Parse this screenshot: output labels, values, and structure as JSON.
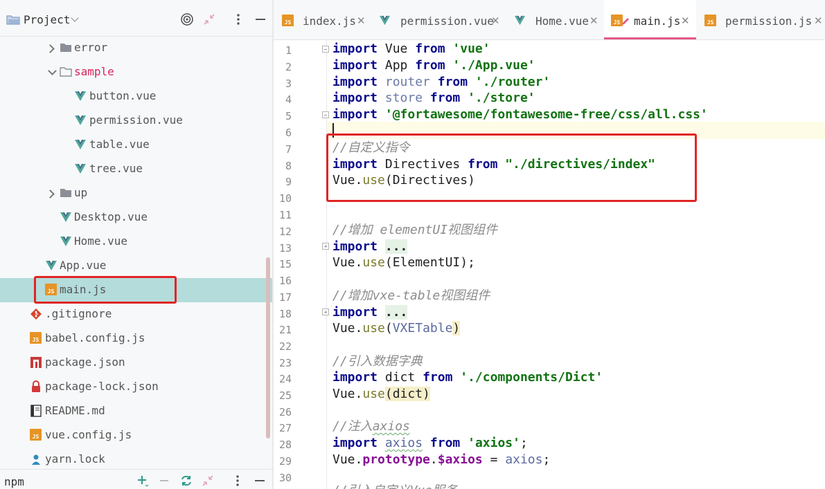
{
  "project_panel": {
    "title": "Project",
    "colors": {
      "selected_row": "#b3dcdb",
      "red_label": "#d6245b",
      "highlight_box": "#e02424"
    },
    "tree": [
      {
        "label": "error",
        "type": "folder",
        "expanded": false
      },
      {
        "label": "sample",
        "type": "folder",
        "expanded": true
      },
      {
        "label": "button.vue",
        "type": "vue"
      },
      {
        "label": "permission.vue",
        "type": "vue"
      },
      {
        "label": "table.vue",
        "type": "vue"
      },
      {
        "label": "tree.vue",
        "type": "vue"
      },
      {
        "label": "up",
        "type": "folder",
        "expanded": false
      },
      {
        "label": "Desktop.vue",
        "type": "vue"
      },
      {
        "label": "Home.vue",
        "type": "vue"
      },
      {
        "label": "App.vue",
        "type": "vue"
      },
      {
        "label": "main.js",
        "type": "js",
        "selected": true
      },
      {
        "label": ".gitignore",
        "type": "git"
      },
      {
        "label": "babel.config.js",
        "type": "js"
      },
      {
        "label": "package.json",
        "type": "npm"
      },
      {
        "label": "package-lock.json",
        "type": "lock"
      },
      {
        "label": "README.md",
        "type": "md"
      },
      {
        "label": "vue.config.js",
        "type": "js"
      },
      {
        "label": "yarn.lock",
        "type": "yarn"
      }
    ],
    "footer": {
      "label": "npm"
    }
  },
  "editor": {
    "tabs": [
      {
        "label": "index.js",
        "icon": "js-file-icon",
        "active": false
      },
      {
        "label": "permission.vue",
        "icon": "vue-file-icon",
        "active": false
      },
      {
        "label": "Home.vue",
        "icon": "vue-file-icon",
        "active": false
      },
      {
        "label": "main.js",
        "icon": "js-file-modified-icon",
        "active": true
      },
      {
        "label": "permission.js",
        "icon": "js-file-icon",
        "active": false
      }
    ],
    "line_numbers": [
      "1",
      "2",
      "3",
      "4",
      "5",
      "6",
      "7",
      "8",
      "9",
      "10",
      "11",
      "12",
      "13",
      "15",
      "16",
      "17",
      "18",
      "21",
      "22",
      "23",
      "24",
      "25",
      "26",
      "27",
      "28",
      "29",
      "30"
    ],
    "code": {
      "l1": {
        "kw": "import",
        "id": " Vue ",
        "kw2": "from",
        "str": " 'vue'"
      },
      "l2": {
        "kw": "import",
        "id": " App ",
        "kw2": "from",
        "str": " './App.vue'"
      },
      "l3": {
        "kw": "import",
        "id": " router ",
        "kw2": "from",
        "str": " './router'"
      },
      "l4": {
        "kw": "import",
        "id": " store ",
        "kw2": "from",
        "str": " './store'"
      },
      "l5": {
        "kw": "import",
        "str": " '@fortawesome/fontawesome-free/css/all.css'"
      },
      "l7": {
        "cm": "//自定义指令"
      },
      "l8": {
        "kw": "import",
        "id": " Directives ",
        "kw2": "from",
        "str": " \"./directives/index\""
      },
      "l9": {
        "a": "Vue.",
        "fn": "use",
        "b": "(Directives)"
      },
      "l12": {
        "cm": "//增加 elementUI视图组件"
      },
      "l13": {
        "kw": "import",
        "fold": "..."
      },
      "l15": {
        "a": "Vue.",
        "fn": "use",
        "b": "(ElementUI);"
      },
      "l17": {
        "cm": "//增加vxe-table视图组件"
      },
      "l18": {
        "kw": "import",
        "fold": "..."
      },
      "l21": {
        "a": "Vue.",
        "fn": "use",
        "b": "(",
        "c": "VXETable",
        "d": ")"
      },
      "l23": {
        "cm": "//引入数据字典"
      },
      "l24": {
        "kw": "import",
        "id": " dict ",
        "kw2": "from",
        "str": " './components/Dict'"
      },
      "l25": {
        "a": "Vue.",
        "fn": "use",
        "b": "(dict)"
      },
      "l27": {
        "cm": "//注入",
        "cm2": "axios"
      },
      "l28": {
        "kw": "import",
        "sp": " ",
        "id": "axios",
        "sp2": " ",
        "kw2": "from",
        "str": " 'axios'",
        "end": ";"
      },
      "l29": {
        "a": "Vue.",
        "prop": "prototype",
        "b": ".",
        "prop2": "$axios",
        "c": " = ",
        "d": "axios",
        "e": ";"
      },
      "l31": {
        "cm": "//引入自定义Vue服务"
      }
    }
  }
}
